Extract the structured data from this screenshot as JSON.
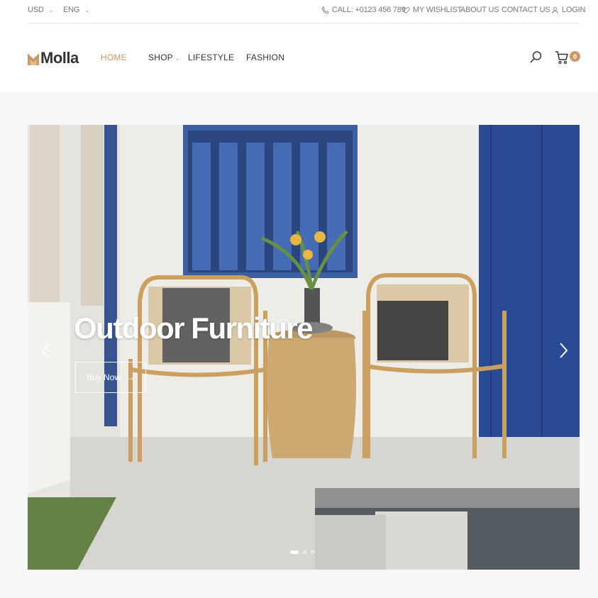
{
  "topbar": {
    "currency": "USD",
    "language": "ENG",
    "phone": "CALL: +0123 456 789",
    "wishlist": "MY WISHLIST",
    "about": "ABOUT US",
    "contact": "CONTACT US",
    "login": "LOGIN"
  },
  "brand": {
    "name": "Molla",
    "accent": "#cc9966"
  },
  "menu": {
    "home": "HOME",
    "shop": "SHOP",
    "lifestyle": "LIFESTYLE",
    "fashion": "FASHION"
  },
  "cart": {
    "count": "0"
  },
  "hero": {
    "title": "Outdoor Furniture",
    "button_label": "Buy Now",
    "button_arrow": "→",
    "slides_total": 3,
    "active_slide": 1
  },
  "icons": {
    "phone": "phone-icon",
    "wishlist": "heart-icon",
    "login": "user-icon",
    "search": "search-icon",
    "cart": "cart-icon",
    "prev": "chevron-left-icon",
    "next": "chevron-right-icon"
  }
}
